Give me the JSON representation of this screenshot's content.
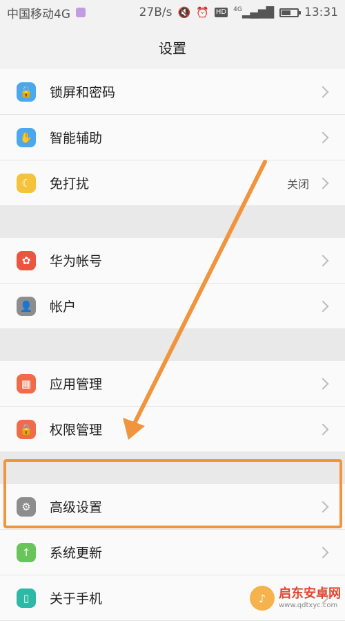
{
  "status_bar": {
    "carrier": "中国移动4G",
    "speed": "27B/s",
    "network": "4G",
    "hd": "HD",
    "time": "13:31",
    "battery_level": 0.6
  },
  "header": {
    "title": "设置"
  },
  "rows": [
    {
      "label": "锁屏和密码",
      "icon": "lock-icon",
      "color": "#4aa8ef",
      "glyph": "🔓"
    },
    {
      "label": "智能辅助",
      "icon": "hand-icon",
      "color": "#4aa8ef",
      "glyph": "✋"
    },
    {
      "label": "免打扰",
      "icon": "moon-icon",
      "color": "#f5c23c",
      "glyph": "☾",
      "value": "关闭"
    },
    {
      "label": "华为帐号",
      "icon": "huawei-icon",
      "color": "#e9553e",
      "glyph": "✿"
    },
    {
      "label": "帐户",
      "icon": "person-icon",
      "color": "#8d8d8d",
      "glyph": "👤"
    },
    {
      "label": "应用管理",
      "icon": "apps-icon",
      "color": "#ef6b4a",
      "glyph": "▦"
    },
    {
      "label": "权限管理",
      "icon": "permission-icon",
      "color": "#ef6b4a",
      "glyph": "🔒"
    },
    {
      "label": "高级设置",
      "icon": "gear-icon",
      "color": "#8d8d8d",
      "glyph": "⚙"
    },
    {
      "label": "系统更新",
      "icon": "update-arrow-icon",
      "color": "#69c45a",
      "glyph": "↑"
    },
    {
      "label": "关于手机",
      "icon": "phone-icon",
      "color": "#2eb8a6",
      "glyph": "▯"
    }
  ],
  "watermark": {
    "main": "启东安卓网",
    "sub": "www.qdtxyc.com"
  },
  "accent": "#f0943e"
}
